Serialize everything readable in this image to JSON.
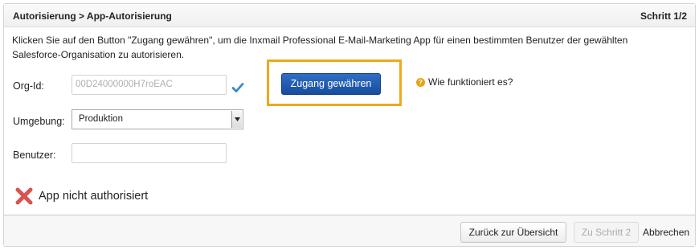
{
  "header": {
    "breadcrumb": "Autorisierung > App-Autorisierung",
    "step": "Schritt 1/2"
  },
  "intro": "Klicken Sie auf den Button \"Zugang gewähren\", um die Inxmail Professional E-Mail-Marketing App für einen bestimmten Benutzer der gewählten Salesforce-Organisation zu autorisieren.",
  "form": {
    "org_id_label": "Org-Id:",
    "org_id_value": "00D24000000H7roEAC",
    "environment_label": "Umgebung:",
    "environment_value": "Produktion",
    "user_label": "Benutzer:",
    "user_value": ""
  },
  "grant_button": "Zugang gewähren",
  "help_link": "Wie funktioniert es?",
  "status": "App nicht authorisiert",
  "footer": {
    "back_button": "Zurück zur Übersicht",
    "next_button": "Zu Schritt 2",
    "cancel_link": "Abbrechen"
  },
  "colors": {
    "primary": "#1f5db3",
    "highlight": "#f0a81c",
    "error": "#d9534f",
    "check": "#3a87c8"
  },
  "icons": {
    "check": "check-icon",
    "help": "question-icon",
    "status": "cross-icon",
    "dropdown": "chevron-down-icon"
  }
}
